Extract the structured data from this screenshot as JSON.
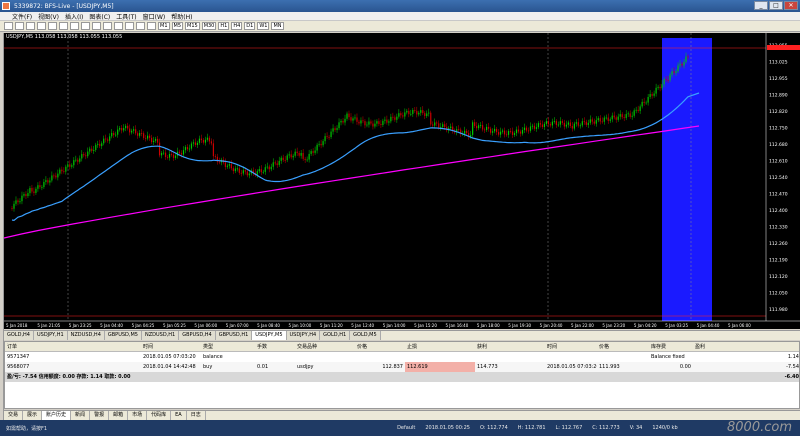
{
  "window": {
    "title": "5339872: BFS-Live - [USDJPY,M5]",
    "minimize": "_",
    "maximize": "□",
    "close": "✕"
  },
  "menu": [
    "文件(F)",
    "视图(V)",
    "插入(I)",
    "图表(C)",
    "工具(T)",
    "窗口(W)",
    "帮助(H)"
  ],
  "toolbar": {
    "timeframes": [
      "M1",
      "M5",
      "M15",
      "M30",
      "H1",
      "H4",
      "D1",
      "W1",
      "MN"
    ]
  },
  "chart": {
    "symbol_label": "USDJPY,M5  113.058 113.058 113.055 113.055",
    "price_labels": [
      "113.055",
      "113.025",
      "112.955",
      "112.890",
      "112.820",
      "112.750",
      "112.680",
      "112.610",
      "112.540",
      "112.470",
      "112.400",
      "112.330",
      "112.260",
      "112.190",
      "112.120",
      "112.050",
      "111.980"
    ],
    "time_labels": [
      "5 Jan 2018",
      "5 Jan 21:05",
      "5 Jan 23:25",
      "5 Jan 04:40",
      "5 Jan 04:25",
      "5 Jan 05:25",
      "5 Jan 06:00",
      "5 Jan 07:00",
      "5 Jan 08:40",
      "5 Jan 10:00",
      "5 Jan 11:20",
      "5 Jan 12:40",
      "5 Jan 14:00",
      "5 Jan 15:20",
      "5 Jan 16:40",
      "5 Jan 18:00",
      "5 Jan 19:30",
      "5 Jan 20:40",
      "5 Jan 22:00",
      "5 Jan 23:20",
      "5 Jan 04:20",
      "5 Jan 03:25",
      "5 Jan 04:40",
      "5 Jan 06:00"
    ]
  },
  "symbol_tabs": [
    "GOLD,H4",
    "USDJPY,H1",
    "NZDUSD,H4",
    "GBPUSD,M5",
    "NZDUSD,H1",
    "GBPUSD,H4",
    "GBPUSD,H1",
    "USDJPY,M5",
    "USDJPY,H4",
    "GOLD,H1",
    "GOLD,M5"
  ],
  "active_symbol_tab": "USDJPY,M5",
  "terminal": {
    "columns": [
      "订单",
      "时间",
      "类型",
      "手数",
      "交易品种",
      "价格",
      "止损",
      "获利",
      "时间",
      "价格",
      "库存费",
      "盈利"
    ],
    "rows": [
      {
        "order": "9571347",
        "time": "2018.01.05 07:03:20",
        "type": "balance",
        "lots": "",
        "symbol": "",
        "price": "",
        "sl": "",
        "tp": "",
        "time2": "",
        "price2": "",
        "swap": "",
        "profit": "Balance fixed",
        "profit2": "1.14"
      },
      {
        "order": "9568077",
        "time": "2018.01.04 14:42:48",
        "type": "buy",
        "lots": "0.01",
        "symbol": "usdjpy",
        "price": "112.837",
        "sl": "112.619",
        "tp": "114.773",
        "time2": "2018.01.05 07:03:20",
        "price2": "111.993",
        "swap": "0.00",
        "profit": "",
        "profit2": "-7.54"
      }
    ],
    "summary": "盈/亏: -7.54  信用额度: 0.00  存款: 1.14  取款: 0.00",
    "summary_value": "-6.40"
  },
  "term_tabs": [
    "交易",
    "展示",
    "账户历史",
    "新闻",
    "警报",
    "邮箱",
    "市场",
    "代码库",
    "EA",
    "日志"
  ],
  "active_term_tab": "账户历史",
  "status": {
    "help": "如需帮助，请按F1",
    "profile": "Default",
    "datetime": "2018.01.05 00:25",
    "o": "O: 112.774",
    "h": "H: 112.781",
    "l": "L: 112.767",
    "c": "C: 112.773",
    "v": "V: 34",
    "traffic": "1240/0 kb",
    "watermark": "8000.com"
  },
  "colors": {
    "bull": "#00cc00",
    "bear": "#cc0000",
    "ma_fast": "#3aa0ff",
    "ma_slow": "#ff00ff",
    "highlight": "#1a1aff",
    "price_line": "#ff2020"
  }
}
